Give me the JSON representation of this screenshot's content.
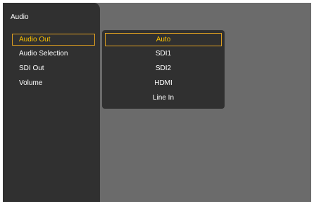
{
  "sidebar": {
    "title": "Audio",
    "items": [
      {
        "label": "Audio Out",
        "selected": true
      },
      {
        "label": "Audio Selection",
        "selected": false
      },
      {
        "label": "SDI Out",
        "selected": false
      },
      {
        "label": "Volume",
        "selected": false
      }
    ]
  },
  "dropdown": {
    "options": [
      {
        "label": "Auto",
        "selected": true
      },
      {
        "label": "SDI1",
        "selected": false
      },
      {
        "label": "SDI2",
        "selected": false
      },
      {
        "label": "HDMI",
        "selected": false
      },
      {
        "label": "Line In",
        "selected": false
      }
    ]
  },
  "colors": {
    "highlight_border": "#e0a020",
    "highlight_text": "#ffc400",
    "panel": "#303030",
    "background": "#6b6b6b"
  }
}
